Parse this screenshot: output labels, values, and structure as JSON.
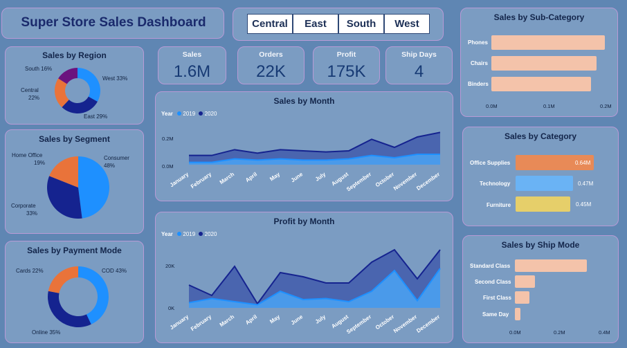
{
  "dashboard": {
    "title": "Super Store Sales Dashboard"
  },
  "slicer": {
    "regions": [
      "Central",
      "East",
      "South",
      "West"
    ]
  },
  "kpis": [
    {
      "label": "Sales",
      "value": "1.6M"
    },
    {
      "label": "Orders",
      "value": "22K"
    },
    {
      "label": "Profit",
      "value": "175K"
    },
    {
      "label": "Ship Days",
      "value": "4"
    }
  ],
  "colors": {
    "panel_bg": "#7b9cc2",
    "page_bg": "#5f86b3",
    "panel_border": "#b89ad6",
    "series_2019": "#1e90ff",
    "series_2020": "#15238f",
    "peach": "#f4c3aa",
    "orange": "#e9733a",
    "purple": "#6b137f",
    "yellow": "#e6cf6a"
  },
  "region": {
    "title": "Sales by Region",
    "labels": [
      "South 16%",
      "West 33%",
      "Central",
      "22%",
      "East 29%"
    ]
  },
  "segment": {
    "title": "Sales by Segment",
    "labels": [
      "Home Office",
      "19%",
      "Consumer",
      "48%",
      "Corporate",
      "33%"
    ]
  },
  "payment": {
    "title": "Sales by Payment Mode",
    "labels": [
      "Cards 22%",
      "COD 43%",
      "Online 35%"
    ]
  },
  "sales_month": {
    "title": "Sales by Month",
    "legend_title": "Year",
    "legend": [
      "2019",
      "2020"
    ],
    "y_ticks": [
      "0.2M",
      "0.0M"
    ]
  },
  "profit_month": {
    "title": "Profit by Month",
    "legend_title": "Year",
    "legend": [
      "2019",
      "2020"
    ],
    "y_ticks": [
      "20K",
      "0K"
    ]
  },
  "months": [
    "January",
    "February",
    "March",
    "April",
    "May",
    "June",
    "July",
    "August",
    "September",
    "October",
    "November",
    "December"
  ],
  "subcategory": {
    "title": "Sales by Sub-Category",
    "categories": [
      "Phones",
      "Chairs",
      "Binders"
    ],
    "axis": [
      "0.0M",
      "0.1M",
      "0.2M"
    ]
  },
  "category": {
    "title": "Sales by Category",
    "categories": [
      "Office Supplies",
      "Technology",
      "Furniture"
    ],
    "value_labels": [
      "0.64M",
      "0.47M",
      "0.45M"
    ]
  },
  "shipmode": {
    "title": "Sales by Ship Mode",
    "categories": [
      "Standard Class",
      "Second Class",
      "First Class",
      "Same Day"
    ],
    "axis": [
      "0.0M",
      "0.2M",
      "0.4M"
    ]
  },
  "chart_data": [
    {
      "type": "pie",
      "title": "Sales by Region",
      "donut": true,
      "categories": [
        "West",
        "East",
        "Central",
        "South"
      ],
      "values": [
        33,
        29,
        22,
        16
      ],
      "colors": [
        "#1e90ff",
        "#15238f",
        "#e9733a",
        "#6b137f"
      ]
    },
    {
      "type": "pie",
      "title": "Sales by Segment",
      "categories": [
        "Consumer",
        "Corporate",
        "Home Office"
      ],
      "values": [
        48,
        33,
        19
      ],
      "colors": [
        "#1e90ff",
        "#15238f",
        "#e9733a"
      ]
    },
    {
      "type": "pie",
      "title": "Sales by Payment Mode",
      "donut": true,
      "categories": [
        "COD",
        "Online",
        "Cards"
      ],
      "values": [
        43,
        35,
        22
      ],
      "colors": [
        "#1e90ff",
        "#15238f",
        "#e9733a"
      ]
    },
    {
      "type": "area",
      "title": "Sales by Month",
      "categories": [
        "January",
        "February",
        "March",
        "April",
        "May",
        "June",
        "July",
        "August",
        "September",
        "October",
        "November",
        "December"
      ],
      "ylim": [
        0,
        0.3
      ],
      "series": [
        {
          "name": "2019",
          "values": [
            0.02,
            0.02,
            0.05,
            0.04,
            0.05,
            0.04,
            0.04,
            0.05,
            0.08,
            0.06,
            0.09,
            0.09
          ]
        },
        {
          "name": "2020",
          "values": [
            0.08,
            0.08,
            0.13,
            0.1,
            0.13,
            0.12,
            0.11,
            0.12,
            0.22,
            0.15,
            0.24,
            0.28
          ]
        }
      ]
    },
    {
      "type": "area",
      "title": "Profit by Month",
      "categories": [
        "January",
        "February",
        "March",
        "April",
        "May",
        "June",
        "July",
        "August",
        "September",
        "October",
        "November",
        "December"
      ],
      "ylim": [
        0,
        30000
      ],
      "series": [
        {
          "name": "2019",
          "values": [
            2500,
            4500,
            3000,
            1500,
            8000,
            4000,
            4500,
            3000,
            8000,
            18000,
            3500,
            19000
          ]
        },
        {
          "name": "2020",
          "values": [
            11000,
            6000,
            20000,
            2000,
            17000,
            15000,
            12000,
            12000,
            22000,
            28000,
            14000,
            28000
          ]
        }
      ]
    },
    {
      "type": "bar",
      "title": "Sales by Sub-Category",
      "orientation": "horizontal",
      "categories": [
        "Phones",
        "Chairs",
        "Binders"
      ],
      "values": [
        0.2,
        0.185,
        0.175
      ],
      "xlim": [
        0,
        0.2
      ]
    },
    {
      "type": "bar",
      "title": "Sales by Category",
      "orientation": "horizontal",
      "categories": [
        "Office Supplies",
        "Technology",
        "Furniture"
      ],
      "values": [
        0.64,
        0.47,
        0.45
      ]
    },
    {
      "type": "bar",
      "title": "Sales by Ship Mode",
      "orientation": "horizontal",
      "categories": [
        "Standard Class",
        "Second Class",
        "First Class",
        "Same Day"
      ],
      "values": [
        0.32,
        0.09,
        0.065,
        0.025
      ],
      "xlim": [
        0,
        0.4
      ]
    }
  ]
}
